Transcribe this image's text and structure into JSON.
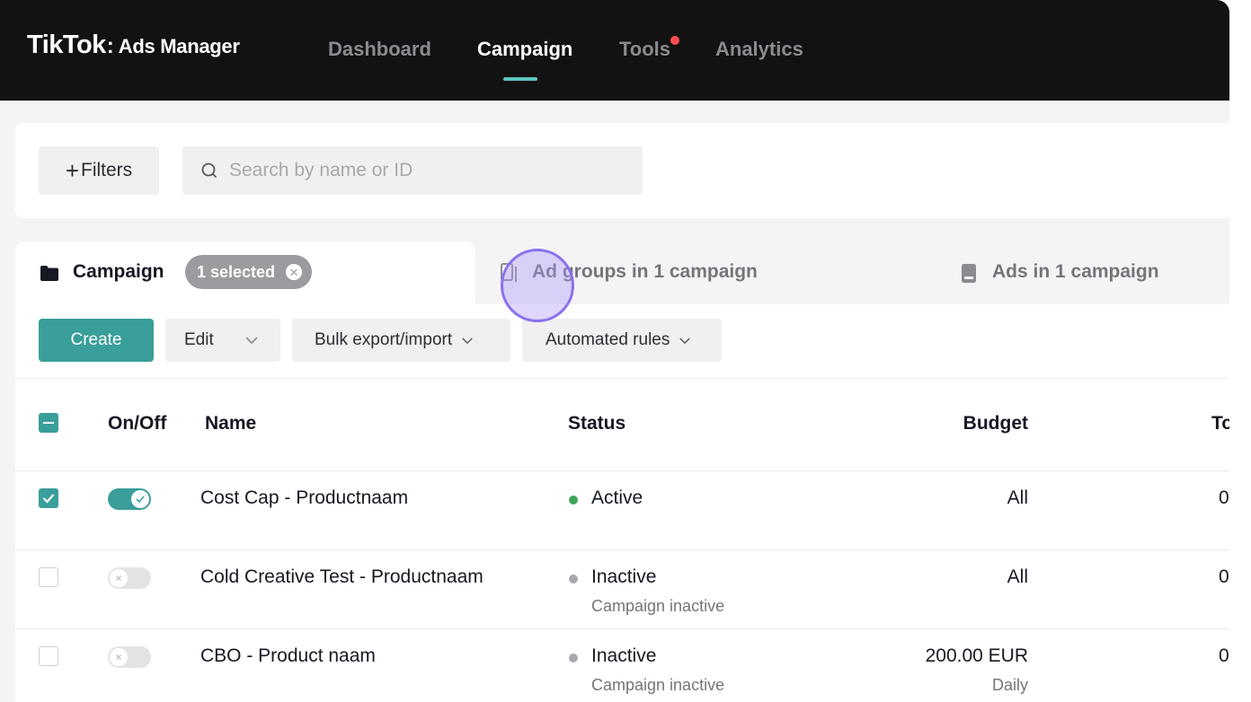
{
  "header": {
    "brand": "TikTok",
    "product": "Ads Manager",
    "nav": [
      {
        "label": "Dashboard"
      },
      {
        "label": "Campaign"
      },
      {
        "label": "Tools"
      },
      {
        "label": "Analytics"
      }
    ],
    "active_nav": "Campaign"
  },
  "filters": {
    "button_label": "Filters",
    "search_placeholder": "Search by name or ID",
    "search_value": ""
  },
  "tabs": {
    "campaign": {
      "label": "Campaign",
      "selected_badge": "1 selected"
    },
    "ad_groups": {
      "label": "Ad groups in 1 campaign"
    },
    "ads": {
      "label": "Ads in 1 campaign"
    }
  },
  "toolbar": {
    "create": "Create",
    "edit": "Edit",
    "bulk": "Bulk export/import",
    "automated": "Automated rules"
  },
  "table": {
    "headers": {
      "onoff": "On/Off",
      "name": "Name",
      "status": "Status",
      "budget": "Budget",
      "total": "To"
    },
    "rows": [
      {
        "checked": true,
        "on": true,
        "name": "Cost Cap - Productnaam",
        "status": "Active",
        "status_sub": "",
        "budget": "All",
        "budget_sub": "",
        "total": "0"
      },
      {
        "checked": false,
        "on": false,
        "name": "Cold Creative Test - Productnaam",
        "status": "Inactive",
        "status_sub": "Campaign inactive",
        "budget": "All",
        "budget_sub": "",
        "total": "0"
      },
      {
        "checked": false,
        "on": false,
        "name": "CBO - Product naam",
        "status": "Inactive",
        "status_sub": "Campaign inactive",
        "budget": "200.00 EUR",
        "budget_sub": "Daily",
        "total": "0"
      }
    ]
  },
  "colors": {
    "accent": "#3a9e9a",
    "nav_underline": "#5fc5c0",
    "active_dot": "#3fa55b",
    "inactive_dot": "#a8a9ad",
    "notification_dot": "#fe4c4c"
  }
}
